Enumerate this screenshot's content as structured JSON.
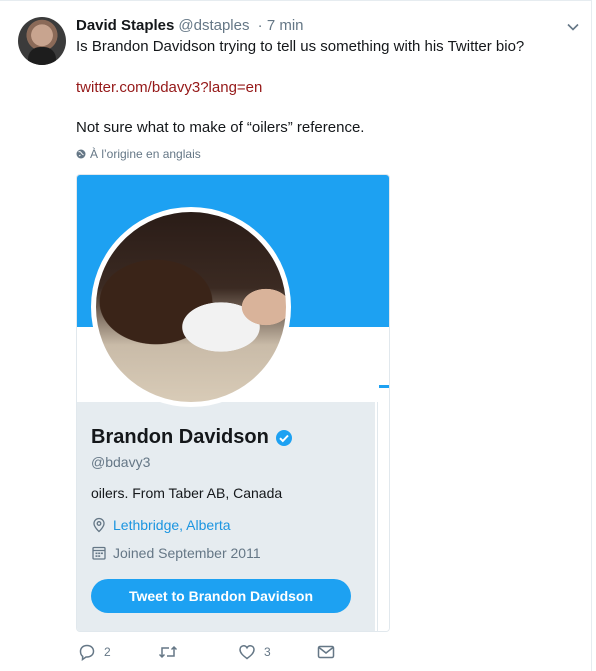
{
  "tweet": {
    "author_name": "David Staples",
    "author_handle": "@dstaples",
    "time": "· 7 min",
    "line1": "Is Brandon Davidson trying to tell us something with his Twitter bio?",
    "link": "twitter.com/bdavy3?lang=en",
    "line3": "Not sure what to make of “oilers” reference.",
    "translate_label": "À l’origine en anglais"
  },
  "profile": {
    "name": "Brandon Davidson",
    "handle": "@bdavy3",
    "bio": "oilers. From Taber AB, Canada",
    "location": "Lethbridge, Alberta",
    "joined": "Joined September 2011",
    "button_label": "Tweet to Brandon Davidson"
  },
  "actions": {
    "reply_count": "2",
    "retweet_count": "",
    "like_count": "3"
  },
  "colors": {
    "accent": "#1da1f2",
    "link": "#951818",
    "muted": "#657786"
  },
  "icons": [
    "chevron-down-icon",
    "globe-icon",
    "verified-badge-icon",
    "location-pin-icon",
    "calendar-icon",
    "reply-icon",
    "retweet-icon",
    "like-icon",
    "message-icon"
  ]
}
